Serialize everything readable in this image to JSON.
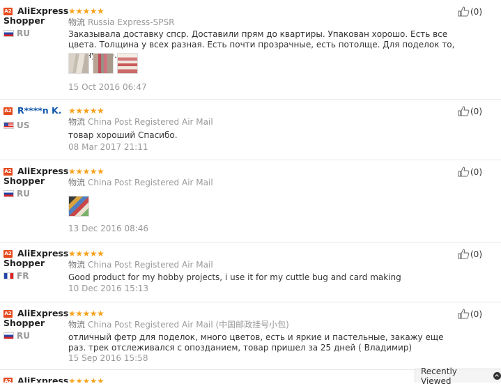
{
  "reviews": [
    {
      "name_line1": "AliExpress",
      "name_line2": "Shopper",
      "badge": "A2",
      "country": "RU",
      "stars": "★★★★★",
      "shipping_label": "物流",
      "shipping": "Russia Express-SPSR",
      "text": "Заказывала доставку спср. Доставили прям до квартиры. Упакован хорошо. Есть все цвета. Толщина у всех разная. Есть почти прозрачные, есть потолще. Для поделок то, что нужно.",
      "date": "15 Oct 2016 06:47",
      "helpful": "(0)"
    },
    {
      "name_line1": "R****n K.",
      "badge": "A2",
      "country": "US",
      "stars": "★★★★★",
      "shipping_label": "物流",
      "shipping": "China Post Registered Air Mail",
      "text": "товар хороший Спасибо.",
      "date": "08 Mar 2017 21:11",
      "helpful": "(0)"
    },
    {
      "name_line1": "AliExpress",
      "name_line2": "Shopper",
      "badge": "A2",
      "country": "RU",
      "stars": "★★★★★",
      "shipping_label": "物流",
      "shipping": "China Post Registered Air Mail",
      "date": "13 Dec 2016 08:46",
      "helpful": "(0)"
    },
    {
      "name_line1": "AliExpress",
      "name_line2": "Shopper",
      "badge": "A2",
      "country": "FR",
      "stars": "★★★★★",
      "shipping_label": "物流",
      "shipping": "China Post Registered Air Mail",
      "text": "Good product for my hobby projects, i use it for my cuttle bug and card making",
      "date": "10 Dec 2016 15:13",
      "helpful": "(0)"
    },
    {
      "name_line1": "AliExpress",
      "name_line2": "Shopper",
      "badge": "A2",
      "country": "RU",
      "stars": "★★★★★",
      "shipping_label": "物流",
      "shipping": "China Post Registered Air Mail (中国邮政挂号小包)",
      "text": "отличный фетр для поделок, много цветов, есть и яркие и пастельные, закажу еще раз. трек отслеживался с опозданием, товар пришел за 25 дней ( Владимир)",
      "date": "15 Sep 2016 15:58",
      "helpful": "(0)"
    },
    {
      "name_line1": "AliExpress",
      "badge": "A2",
      "stars": "★★★★★"
    }
  ],
  "recently_viewed": "Recently Viewed",
  "icons": {
    "thumbs_up": "thumbs-up-icon",
    "chevron": "chevron-up-icon"
  },
  "colors": {
    "badge": "#e64b1e",
    "stars": "#f7a21b",
    "muted": "#999999"
  }
}
